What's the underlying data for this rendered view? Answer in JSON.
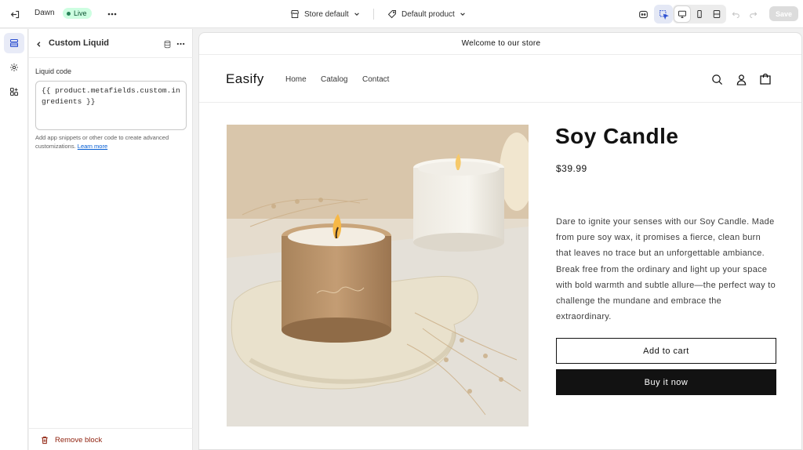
{
  "topbar": {
    "theme_name": "Dawn",
    "live_badge": "Live",
    "store_selector": "Store default",
    "template_selector": "Default product",
    "save_label": "Save"
  },
  "panel": {
    "title": "Custom Liquid",
    "field_label": "Liquid code",
    "code_value": "{{ product.metafields.custom.ingredients }}",
    "help_text": "Add app snippets or other code to create advanced customizations.",
    "help_link": "Learn more",
    "remove_label": "Remove block"
  },
  "preview": {
    "announcement": "Welcome to our store",
    "logo": "Easify",
    "nav": [
      "Home",
      "Catalog",
      "Contact"
    ],
    "product": {
      "title": "Soy Candle",
      "price": "$39.99",
      "description": "Dare to ignite your senses with our Soy Candle. Made from pure soy wax, it promises a fierce, clean burn that leaves no trace but an unforgettable ambiance. Break free from the ordinary and light up your space with bold warmth and subtle allure—the perfect way to challenge the mundane and embrace the extraordinary.",
      "add_to_cart": "Add to cart",
      "buy_now": "Buy it now"
    }
  },
  "icons": {
    "exit": "exit-icon",
    "more": "more-horizontal-icon",
    "store": "store-icon",
    "tag": "tag-icon",
    "chevron": "chevron-down-icon",
    "sections": "sections-icon",
    "settings": "gear-icon",
    "apps": "apps-icon",
    "back": "chevron-left-icon",
    "database": "database-icon",
    "trash": "trash-icon",
    "search": "search-icon",
    "account": "account-icon",
    "cart": "cart-icon"
  },
  "colors": {
    "live_badge_bg": "#cdfee1",
    "live_badge_text": "#0c5132",
    "link": "#005bd3",
    "remove": "#8e1f0b",
    "buy_button": "#121212"
  }
}
